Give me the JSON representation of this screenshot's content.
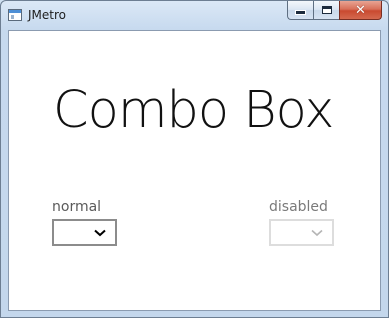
{
  "window": {
    "title": "JMetro",
    "caption_buttons": {
      "minimize": "minimize",
      "maximize": "maximize",
      "close": "✕"
    }
  },
  "main": {
    "heading": "Combo Box",
    "combos": [
      {
        "label": "normal",
        "value": "",
        "state": "enabled"
      },
      {
        "label": "disabled",
        "value": "",
        "state": "disabled"
      }
    ]
  },
  "colors": {
    "combo_border_enabled": "#8c8c8c",
    "combo_border_disabled": "#dddddd",
    "chevron_enabled": "#000000",
    "chevron_disabled": "#b5b5b5",
    "close_button": "#c94a30"
  }
}
